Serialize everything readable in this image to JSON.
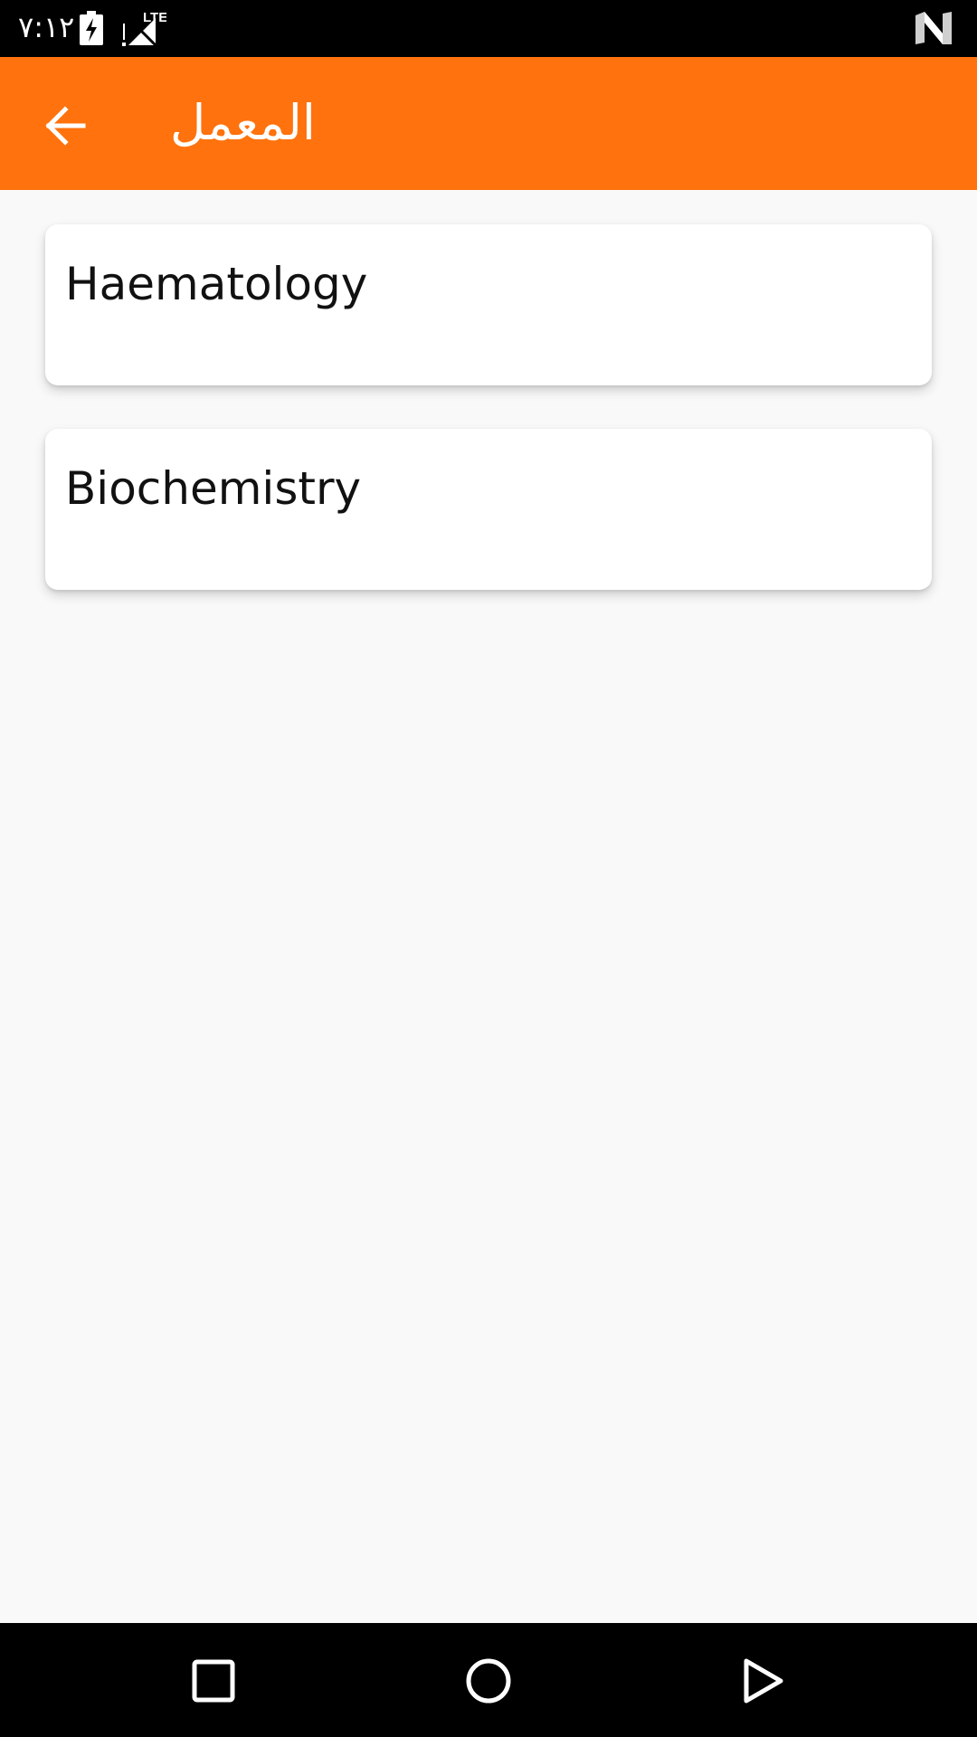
{
  "status_bar": {
    "time": "٧:١٢",
    "network_label": "LTE",
    "icons": [
      "battery-charging-icon",
      "cell-signal-icon",
      "n-notification-icon"
    ]
  },
  "app_bar": {
    "title": "المعمل",
    "back_icon": "arrow-back-icon",
    "background_color": "#ff720d"
  },
  "list": {
    "items": [
      {
        "label": "Haematology"
      },
      {
        "label": "Biochemistry"
      }
    ]
  },
  "nav_bar": {
    "buttons": [
      "recents-square-icon",
      "home-circle-icon",
      "back-triangle-icon"
    ]
  }
}
